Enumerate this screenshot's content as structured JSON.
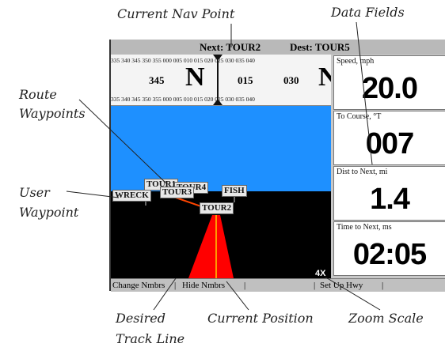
{
  "callouts": {
    "current_nav_point": "Current Nav Point",
    "data_fields": "Data Fields",
    "route_waypoints_1": "Route",
    "route_waypoints_2": "Waypoints",
    "user_waypoint_1": "User",
    "user_waypoint_2": "Waypoint",
    "desired_track_1": "Desired",
    "desired_track_2": "Track Line",
    "current_position": "Current Position",
    "zoom_scale": "Zoom Scale"
  },
  "header": {
    "next": "Next: TOUR2",
    "dest": "Dest: TOUR5"
  },
  "compass": {
    "ticks": "335 340 345 350 355 000 005 010 015 020 025 030 035 040",
    "heading_345": "345",
    "cardinal_n": "N",
    "heading_015": "015",
    "heading_030": "030",
    "cardinal_n2": "N"
  },
  "waypoints": {
    "tour1": "TOUR1",
    "tour4": "TOUR4",
    "tour3": "TOUR3",
    "wreck": "WRECK",
    "fish": "FISH",
    "tour2": "TOUR2"
  },
  "fields": [
    {
      "label": "Speed, mph",
      "value": "20.0"
    },
    {
      "label": "To Course, °T",
      "value": "007"
    },
    {
      "label": "Dist to Next, mi",
      "value": "1.4"
    },
    {
      "label": "Time to Next, ms",
      "value": "02:05"
    }
  ],
  "softkeys": {
    "change_nmbrs": "Change Nmbrs",
    "hide_nmbrs": "Hide Nmbrs",
    "set_up_hwy": "Set Up Hwy"
  },
  "zoom": "4X",
  "colors": {
    "sky": "#1e90ff",
    "track": "#ff0000",
    "route": "#ff4500"
  }
}
